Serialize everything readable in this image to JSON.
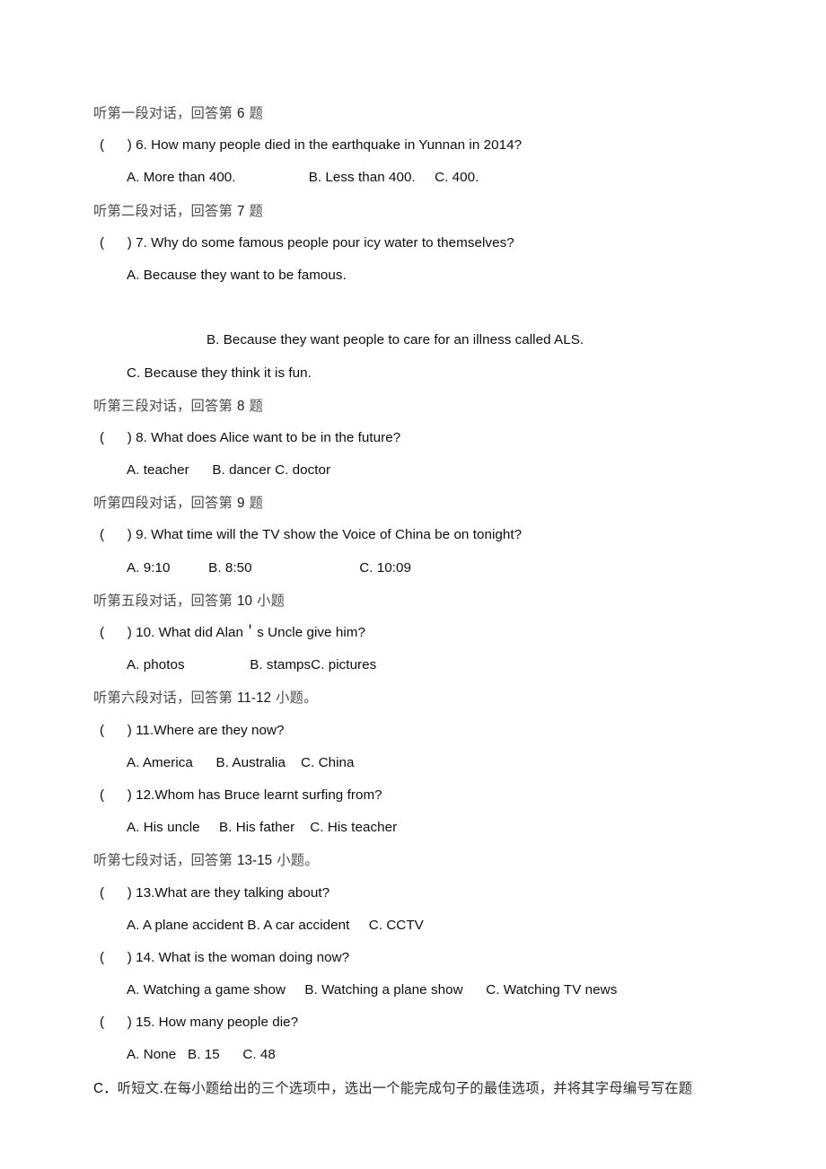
{
  "document": {
    "type": "listening-comprehension-exam",
    "blocks": [
      {
        "kind": "cn-head",
        "id": "head-dialogue-1",
        "prefix": "听第一段对话，回答第 ",
        "number": "6",
        "suffix": " 题"
      },
      {
        "kind": "question",
        "id": "question-6",
        "text": "(      ) 6. How many people died in the earthquake in Yunnan in 2014?"
      },
      {
        "kind": "options",
        "id": "options-6",
        "text": "A. More than 400.                   B. Less than 400.     C. 400."
      },
      {
        "kind": "cn-head",
        "id": "head-dialogue-2",
        "prefix": "听第二段对话，回答第 ",
        "number": "7",
        "suffix": " 题"
      },
      {
        "kind": "question",
        "id": "question-7",
        "text": "(      ) 7. Why do some famous people pour icy water to themselves?"
      },
      {
        "kind": "options",
        "id": "options-7-a",
        "text": "A. Because they want to be famous."
      },
      {
        "kind": "options-deep",
        "id": "options-7-b",
        "text": "B. Because they want people to care for an illness called ALS."
      },
      {
        "kind": "options",
        "id": "options-7-c",
        "text": "C. Because they think it is fun."
      },
      {
        "kind": "cn-head",
        "id": "head-dialogue-3",
        "prefix": "听第三段对话，回答第 ",
        "number": "8",
        "suffix": " 题"
      },
      {
        "kind": "question",
        "id": "question-8",
        "text": "(      ) 8. What does Alice want to be in the future?"
      },
      {
        "kind": "options",
        "id": "options-8",
        "text": "A. teacher      B. dancer C. doctor"
      },
      {
        "kind": "cn-head",
        "id": "head-dialogue-4",
        "prefix": "听第四段对话，回答第 ",
        "number": "9",
        "suffix": " 题"
      },
      {
        "kind": "question",
        "id": "question-9",
        "text": "(      ) 9. What time will the TV show the Voice of China be on tonight?"
      },
      {
        "kind": "options",
        "id": "options-9",
        "text": "A. 9:10          B. 8:50                            C. 10:09"
      },
      {
        "kind": "cn-head",
        "id": "head-dialogue-5",
        "prefix": "听第五段对话，回答第 ",
        "number": "10",
        "suffix": " 小题"
      },
      {
        "kind": "question",
        "id": "question-10",
        "text": "(      ) 10. What did Alan＇s Uncle give him?"
      },
      {
        "kind": "options",
        "id": "options-10",
        "text": "A. photos                 B. stampsC. pictures"
      },
      {
        "kind": "cn-head",
        "id": "head-dialogue-6",
        "prefix": "听第六段对话，回答第 ",
        "number": "11-12",
        "suffix": " 小题。"
      },
      {
        "kind": "question",
        "id": "question-11",
        "text": "(      ) 11.Where are they now?"
      },
      {
        "kind": "options",
        "id": "options-11",
        "text": "A. America      B. Australia    C. China"
      },
      {
        "kind": "question",
        "id": "question-12",
        "text": "(      ) 12.Whom has Bruce learnt surfing from?"
      },
      {
        "kind": "options",
        "id": "options-12",
        "text": "A. His uncle     B. His father    C. His teacher"
      },
      {
        "kind": "cn-head",
        "id": "head-dialogue-7",
        "prefix": "听第七段对话，回答第 ",
        "number": "13-15",
        "suffix": " 小题。"
      },
      {
        "kind": "question",
        "id": "question-13",
        "text": "(      ) 13.What are they talking about?"
      },
      {
        "kind": "options",
        "id": "options-13",
        "text": "A. A plane accident B. A car accident     C. CCTV"
      },
      {
        "kind": "question",
        "id": "question-14",
        "text": "(      ) 14. What is the woman doing now?"
      },
      {
        "kind": "options",
        "id": "options-14",
        "text": "A. Watching a game show     B. Watching a plane show      C. Watching TV news"
      },
      {
        "kind": "question",
        "id": "question-15",
        "text": "(      ) 15. How many people die?"
      },
      {
        "kind": "options",
        "id": "options-15",
        "text": "A. None   B. 15      C. 48"
      },
      {
        "kind": "cn-tail",
        "id": "section-c-instruction",
        "lead": "C．",
        "text": "听短文.在每小题给出的三个选项中，选出一个能完成句子的最佳选项，并将其字母编号写在题"
      }
    ]
  }
}
